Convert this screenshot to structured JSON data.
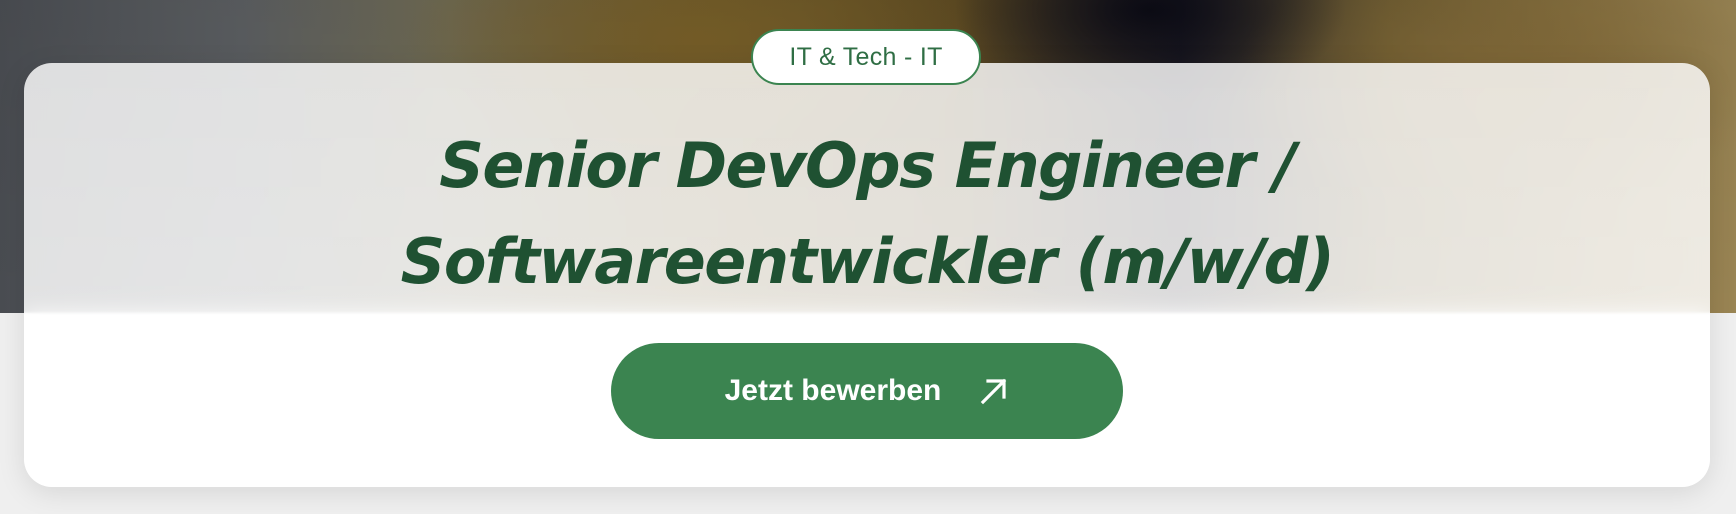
{
  "badge": {
    "label": "IT & Tech - IT"
  },
  "job": {
    "title_line1": "Senior DevOps Engineer /",
    "title_line2": "Softwareentwickler (m/w/d)"
  },
  "cta": {
    "label": "Jetzt bewerben",
    "icon": "arrow-up-right-icon"
  },
  "colors": {
    "accent": "#3b8450",
    "title": "#1f5132",
    "badge_text": "#2f6e44",
    "card": "#ffffff"
  }
}
